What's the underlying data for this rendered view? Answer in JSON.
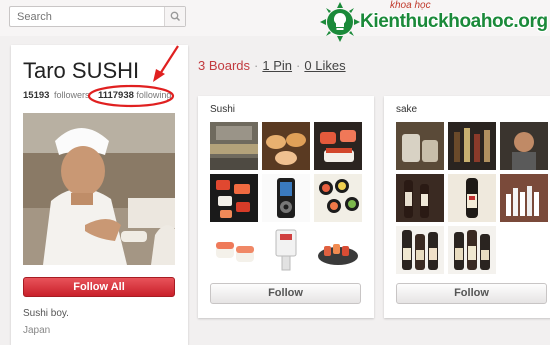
{
  "search": {
    "placeholder": "Search"
  },
  "watermark": {
    "text": "Kienthuckhoahoc.org",
    "subtext": "khoa học"
  },
  "profile": {
    "name": "Taro SUSHI",
    "followers_count": "15193",
    "followers_label": "followers",
    "following_count": "1117938",
    "following_label": "following",
    "follow_all_label": "Follow All",
    "bio": "Sushi boy.",
    "location": "Japan"
  },
  "tabs": [
    {
      "label": "3 Boards"
    },
    {
      "label": "1 Pin"
    },
    {
      "label": "0 Likes"
    }
  ],
  "boards": [
    {
      "title": "Sushi",
      "follow_label": "Follow"
    },
    {
      "title": "sake",
      "follow_label": "Follow"
    }
  ],
  "colors": {
    "accent": "#c23b3f",
    "annotation": "#e02020",
    "background": "#f2f0f0"
  }
}
